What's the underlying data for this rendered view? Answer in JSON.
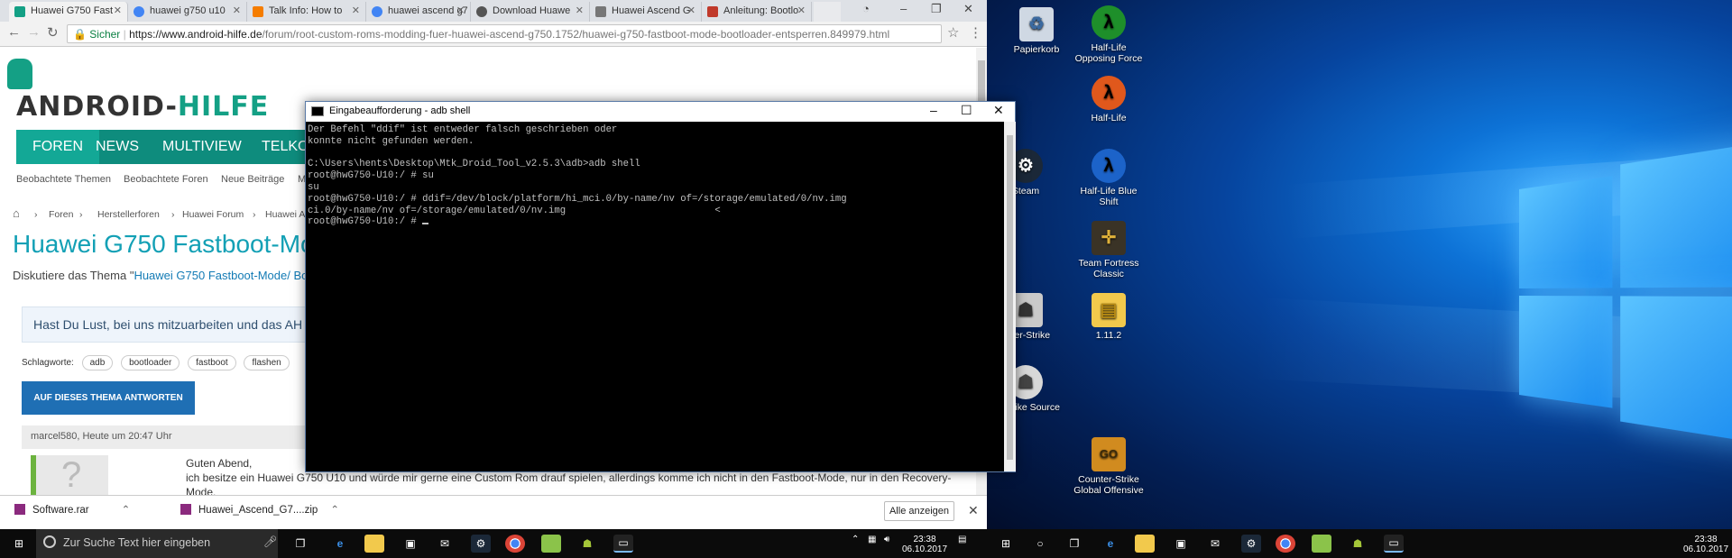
{
  "browser": {
    "tabs": [
      {
        "label": "Huawei G750 Fast",
        "active": true,
        "favicon_color": "#14a085"
      },
      {
        "label": "huawei g750 u10",
        "active": false,
        "favicon_color": "#4285f4"
      },
      {
        "label": "Talk Info: How to",
        "active": false,
        "favicon_color": "#f57d00"
      },
      {
        "label": "huawei ascend g7",
        "active": false,
        "favicon_color": "#4285f4"
      },
      {
        "label": "Download Huawe",
        "active": false,
        "favicon_color": "#555555"
      },
      {
        "label": "Huawei Ascend G",
        "active": false,
        "favicon_color": "#777777"
      },
      {
        "label": "Anleitung: Bootlo",
        "active": false,
        "favicon_color": "#c0392b"
      }
    ],
    "address": {
      "secure_label": "Sicher",
      "url_host": "https://www.android-hilfe.de",
      "url_path": "/forum/root-custom-roms-modding-fuer-huawei-ascend-g750.1752/huawei-g750-fastboot-mode-bootloader-entsperren.849979.html"
    }
  },
  "site": {
    "logo_part1": "ANDROID-",
    "logo_part2": "HILFE",
    "nav": [
      "FOREN",
      "NEWS",
      "MULTIVIEW",
      "TELKO"
    ],
    "subnav": [
      "Beobachtete Themen",
      "Beobachtete Foren",
      "Neue Beiträge",
      "M"
    ],
    "breadcrumb": [
      "Foren",
      "Herstellerforen",
      "Huawei Forum",
      "Huawei As"
    ],
    "title": "Huawei G750 Fastboot-Mo",
    "desc_prefix": "Diskutiere das Thema \"",
    "desc_link": "Huawei G750 Fastboot-Mode/ Bo",
    "promo": "Hast Du Lust, bei uns mitzuarbeiten und das AH",
    "tags_label": "Schlagworte:",
    "tags": [
      "adb",
      "bootloader",
      "fastboot",
      "flashen"
    ],
    "reply_button": "AUF DIESES THEMA ANTWORTEN",
    "post_meta": "marcel580, Heute um 20:47 Uhr",
    "post_line1": "Guten Abend,",
    "post_line2": "ich besitze ein Huawei G750 U10 und würde mir gerne eine Custom Rom drauf spielen, allerdings komme ich nicht in den Fastboot-Mode, nur in den Recovery-",
    "post_line3": "Mode."
  },
  "downloads": {
    "items": [
      "Software.rar",
      "Huawei_Ascend_G7....zip"
    ],
    "show_all": "Alle anzeigen"
  },
  "cmd": {
    "title": "Eingabeaufforderung - adb  shell",
    "output": "Der Befehl \"ddif\" ist entweder falsch geschrieben oder\nkonnte nicht gefunden werden.\n\nC:\\Users\\hents\\Desktop\\Mtk_Droid_Tool_v2.5.3\\adb>adb shell\nroot@hwG750-U10:/ # su\nsu\nroot@hwG750-U10:/ # ddif=/dev/block/platform/hi_mci.0/by-name/nv of=/storage/emulated/0/nv.img\nci.0/by-name/nv of=/storage/emulated/0/nv.img                          <\nroot@hwG750-U10:/ # "
  },
  "desktop": {
    "icons": [
      {
        "label": "Papierkorb",
        "icon": "recycle-bin-icon",
        "color": "#cfd8e3"
      },
      {
        "label": "Half-Life Opposing Force",
        "icon": "half-life-of-icon",
        "color": "#1e8f2a"
      },
      {
        "label": "Half-Life",
        "icon": "half-life-icon",
        "color": "#e0581c"
      },
      {
        "label": "Steam",
        "icon": "steam-icon",
        "color": "#1b2838"
      },
      {
        "label": "Half-Life Blue Shift",
        "icon": "half-life-bs-icon",
        "color": "#1c63c9"
      },
      {
        "label": "Team Fortress Classic",
        "icon": "tfc-icon",
        "color": "#3a3326"
      },
      {
        "label": "unter-Strike",
        "icon": "counter-strike-icon",
        "color": "#c9c9c9"
      },
      {
        "label": "1.11.2",
        "icon": "folder-icon",
        "color": "#f2c94c"
      },
      {
        "label": "er-Strike Source",
        "icon": "cs-source-icon",
        "color": "#d8d8d8"
      },
      {
        "label": "Counter-Strike Global Offensive",
        "icon": "csgo-icon",
        "color": "#d18b1f"
      }
    ]
  },
  "taskbar_left": {
    "search_placeholder": "Zur Suche Text hier eingeben",
    "time": "23:38",
    "date": "06.10.2017"
  },
  "taskbar_right": {
    "time": "23:38",
    "date": "06.10.2017"
  }
}
